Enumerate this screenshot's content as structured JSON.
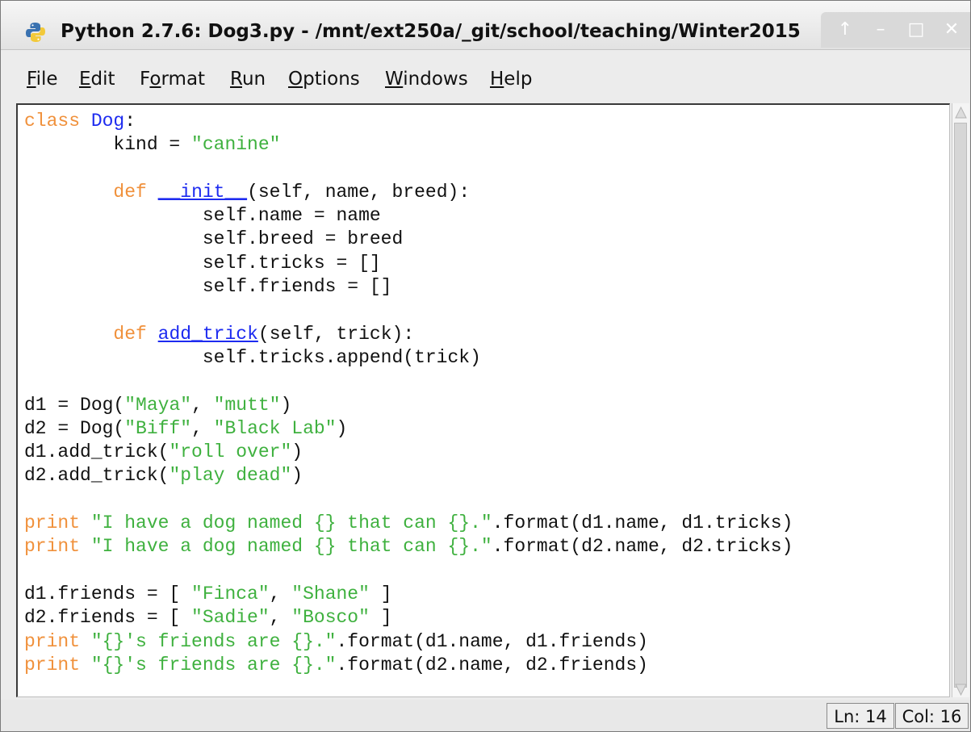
{
  "window": {
    "title": "Python 2.7.6: Dog3.py - /mnt/ext250a/_git/school/teaching/Winter2015",
    "buttons": {
      "up": "↑",
      "minimize": "–",
      "maximize": "□",
      "close": "✕"
    }
  },
  "menu": [
    {
      "underline": "F",
      "rest": "ile"
    },
    {
      "underline": "E",
      "rest": "dit"
    },
    {
      "pre": "F",
      "underline": "o",
      "rest": "rmat"
    },
    {
      "underline": "R",
      "rest": "un"
    },
    {
      "underline": "O",
      "rest": "ptions"
    },
    {
      "underline": "W",
      "rest": "indows"
    },
    {
      "underline": "H",
      "rest": "elp"
    }
  ],
  "code": {
    "l1": {
      "kw": "class",
      "name": "Dog",
      "rest": ":"
    },
    "l2": {
      "indent": "        ",
      "pre": "kind = ",
      "str": "\"canine\""
    },
    "l4": {
      "indent": "        ",
      "kw": "def",
      "name": "__init__",
      "rest": "(self, name, breed):"
    },
    "l5": {
      "text": "                self.name = name"
    },
    "l6": {
      "text": "                self.breed = breed"
    },
    "l7": {
      "text": "                self.tricks = []"
    },
    "l8": {
      "text": "                self.friends = []"
    },
    "l10": {
      "indent": "        ",
      "kw": "def",
      "name": "add_trick",
      "rest": "(self, trick):"
    },
    "l11": {
      "text": "                self.tricks.append(trick)"
    },
    "l13": {
      "pre": "d1 = Dog(",
      "s1": "\"Maya\"",
      "mid": ", ",
      "s2": "\"mutt\"",
      "post": ")"
    },
    "l14": {
      "pre": "d2 = Dog(",
      "s1": "\"Biff\"",
      "mid": ", ",
      "s2": "\"Black Lab\"",
      "post": ")"
    },
    "l15": {
      "pre": "d1.add_trick(",
      "str": "\"roll over\"",
      "post": ")"
    },
    "l16": {
      "pre": "d2.add_trick(",
      "str": "\"play dead\"",
      "post": ")"
    },
    "l18": {
      "kw": "print",
      "str": "\"I have a dog named {} that can {}.\"",
      "post": ".format(d1.name, d1.tricks)"
    },
    "l19": {
      "kw": "print",
      "str": "\"I have a dog named {} that can {}.\"",
      "post": ".format(d2.name, d2.tricks)"
    },
    "l21": {
      "pre": "d1.friends = [ ",
      "s1": "\"Finca\"",
      "mid": ", ",
      "s2": "\"Shane\"",
      "post": " ]"
    },
    "l22": {
      "pre": "d2.friends = [ ",
      "s1": "\"Sadie\"",
      "mid": ", ",
      "s2": "\"Bosco\"",
      "post": " ]"
    },
    "l23": {
      "kw": "print",
      "str": "\"{}'s friends are {}.\"",
      "post": ".format(d1.name, d1.friends)"
    },
    "l24": {
      "kw": "print",
      "str": "\"{}'s friends are {}.\"",
      "post": ".format(d2.name, d2.friends)"
    }
  },
  "status": {
    "line": "Ln: 14",
    "col": "Col: 16"
  },
  "colors": {
    "keyword": "#f0913c",
    "definition": "#1d2bf0",
    "string": "#3fb13f",
    "text": "#111111"
  },
  "icons": {
    "app": "python-logo-icon"
  }
}
